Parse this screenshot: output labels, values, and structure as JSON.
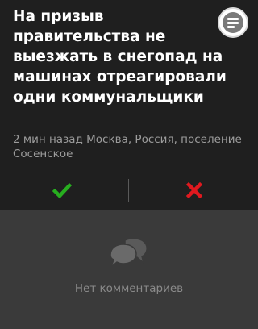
{
  "article": {
    "headline": "На призыв правительства не выезжать в снегопад на машинах отреагировали одни коммунальщики",
    "meta": "2 мин назад Москва, Россия, поселение Сосенское"
  },
  "comments": {
    "empty_text": "Нет комментариев"
  },
  "colors": {
    "approve": "#27ae1f",
    "reject": "#e0191f"
  },
  "icons": {
    "menu": "menu-lines-icon",
    "approve": "checkmark-icon",
    "reject": "cross-icon",
    "comments": "speech-bubbles-icon"
  }
}
